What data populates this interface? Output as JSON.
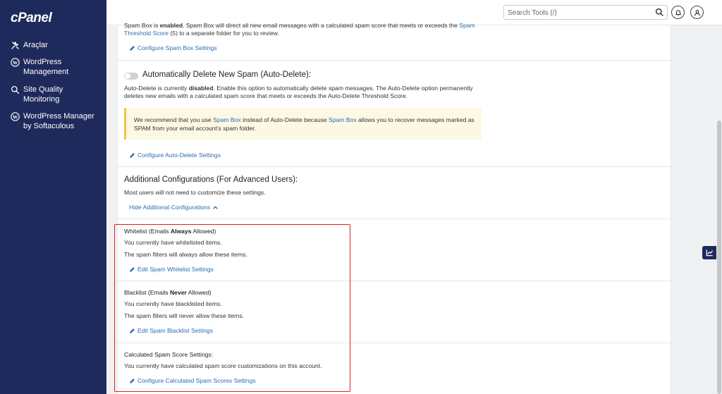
{
  "brand": {
    "logo": "cPanel"
  },
  "sidebar": {
    "items": [
      {
        "label": "Araçlar",
        "icon": "tools-icon"
      },
      {
        "label": "WordPress Management",
        "icon": "wordpress-icon"
      },
      {
        "label": "Site Quality Monitoring",
        "icon": "magnifier-icon"
      },
      {
        "label": "WordPress Manager by Softaculous",
        "icon": "wordpress-icon"
      }
    ]
  },
  "header": {
    "search_placeholder": "Search Tools (/)"
  },
  "spam_box": {
    "text_pre": "Spam Box is ",
    "text_bold": "enabled",
    "text_mid": ". Spam Box will direct all new email messages with a calculated spam score that meets or exceeds the ",
    "text_link": "Spam Threshold Score",
    "text_post": " (5) to a separate folder for you to review.",
    "configure_label": "Configure Spam Box Settings"
  },
  "auto_delete": {
    "title": "Automatically Delete New Spam (Auto-Delete):",
    "text_pre": "Auto-Delete is currently ",
    "text_bold": "disabled",
    "text_post": ". Enable this option to automatically delete spam messages. The Auto-Delete option permanently deletes new emails with a calculated spam score that meets or exceeds the Auto-Delete Threshold Score.",
    "warning_pre": "We recommend that you use ",
    "warning_link1": "Spam Box",
    "warning_mid": " instead of Auto-Delete because ",
    "warning_link2": "Spam Box",
    "warning_post": " allows you to recover messages marked as SPAM from your email account’s spam folder.",
    "configure_label": "Configure Auto-Delete Settings"
  },
  "additional": {
    "title": "Additional Configurations (For Advanced Users):",
    "subtitle": "Most users will not need to customize these settings.",
    "toggle_label": "Hide Additional Configurations"
  },
  "whitelist": {
    "title_pre": "Whitelist (Emails ",
    "title_bold": "Always",
    "title_post": " Allowed)",
    "line1": "You currently have whitelisted items.",
    "line2": "The spam filters will always allow these items.",
    "edit_label": "Edit Spam Whitelist Settings"
  },
  "blacklist": {
    "title_pre": "Blacklist (Emails ",
    "title_bold": "Never",
    "title_post": " Allowed)",
    "line1": "You currently have blacklisted items.",
    "line2": "The spam filters will never allow these items.",
    "edit_label": "Edit Spam Blacklist Settings"
  },
  "score": {
    "title": "Calculated Spam Score Settings:",
    "line1": "You currently have calculated spam score customizations on this account.",
    "configure_label": "Configure Calculated Spam Scores Settings"
  },
  "colors": {
    "sidebar": "#1f2a5c",
    "link": "#2c6cb0",
    "highlight": "#e02020",
    "warning_bg": "#fdf8e3"
  }
}
